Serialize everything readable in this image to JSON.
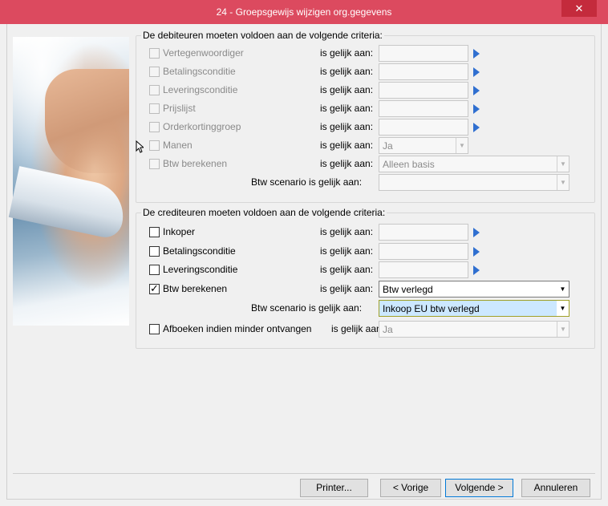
{
  "window": {
    "title": "24 - Groepsgewijs wijzigen org.gegevens",
    "close_label": "✕"
  },
  "debiteuren": {
    "legend": "De debiteuren moeten voldoen aan de volgende criteria:",
    "rows": [
      {
        "label": "Vertegenwoordiger",
        "eq": "is gelijk aan:",
        "value": ""
      },
      {
        "label": "Betalingsconditie",
        "eq": "is gelijk aan:",
        "value": ""
      },
      {
        "label": "Leveringsconditie",
        "eq": "is gelijk aan:",
        "value": ""
      },
      {
        "label": "Prijslijst",
        "eq": "is gelijk aan:",
        "value": ""
      },
      {
        "label": "Orderkortinggroep",
        "eq": "is gelijk aan:",
        "value": ""
      },
      {
        "label": "Manen",
        "eq": "is gelijk aan:",
        "value": "Ja"
      },
      {
        "label": "Btw berekenen",
        "eq": "is gelijk aan:",
        "value": "Alleen basis"
      },
      {
        "label": "",
        "eq": "Btw scenario is gelijk aan:",
        "value": ""
      }
    ]
  },
  "crediteuren": {
    "legend": "De crediteuren moeten voldoen aan de volgende criteria:",
    "rows": [
      {
        "label": "Inkoper",
        "eq": "is gelijk aan:",
        "value": "",
        "checked": false
      },
      {
        "label": "Betalingsconditie",
        "eq": "is gelijk aan:",
        "value": "",
        "checked": false
      },
      {
        "label": "Leveringsconditie",
        "eq": "is gelijk aan:",
        "value": "",
        "checked": false
      },
      {
        "label": "Btw berekenen",
        "eq": "is gelijk aan:",
        "value": "Btw verlegd",
        "checked": true
      },
      {
        "label": "",
        "eq": "Btw scenario is gelijk aan:",
        "value": "Inkoop EU btw verlegd"
      },
      {
        "label": "Afboeken indien minder ontvangen",
        "eq": "is gelijk aan:",
        "value": "Ja",
        "checked": false
      }
    ]
  },
  "buttons": {
    "printer": "Printer...",
    "previous": "< Vorige",
    "next": "Volgende >",
    "cancel": "Annuleren"
  },
  "colors": {
    "titlebar": "#dc4a5f",
    "close": "#c42b3c",
    "arrow": "#2f6fd0",
    "highlight": "#cce8ff"
  }
}
